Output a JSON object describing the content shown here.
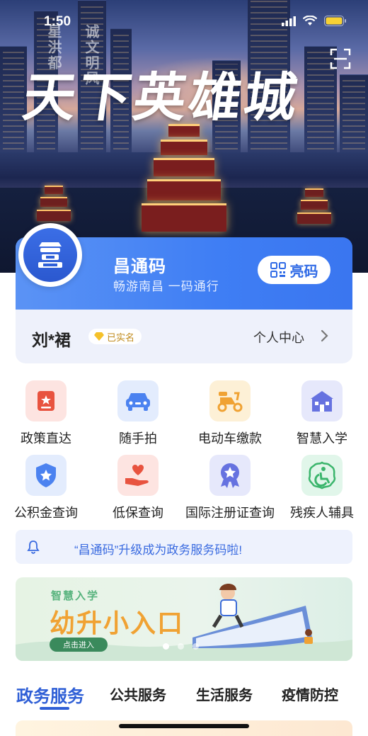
{
  "status_bar": {
    "time": "1:50"
  },
  "hero": {
    "calligraphy": "天下英雄城",
    "vertical_left": "星洪都",
    "vertical_mid": "诚文明风"
  },
  "code_card": {
    "title": "昌通码",
    "subtitle": "畅游南昌 一码通行",
    "show_code_label": "亮码",
    "user_name": "刘*裙",
    "verified_label": "已实名",
    "personal_center_label": "个人中心"
  },
  "grid": [
    {
      "label": "政策直达",
      "icon": "policy-icon",
      "bg": "#fde4e1",
      "color": "#e8533f"
    },
    {
      "label": "随手拍",
      "icon": "car-icon",
      "bg": "#e3ecfd",
      "color": "#4b82f0"
    },
    {
      "label": "电动车缴款",
      "icon": "ebike-icon",
      "bg": "#fdf0d6",
      "color": "#f0a233"
    },
    {
      "label": "智慧入学",
      "icon": "school-icon",
      "bg": "#e6e8fb",
      "color": "#6672e0"
    },
    {
      "label": "公积金查询",
      "icon": "shield-star-icon",
      "bg": "#e3ecfd",
      "color": "#4b82f0"
    },
    {
      "label": "低保查询",
      "icon": "heart-hand-icon",
      "bg": "#fde4e1",
      "color": "#e8533f"
    },
    {
      "label": "国际注册证查询",
      "icon": "medal-icon",
      "bg": "#e6e8fb",
      "color": "#6672e0"
    },
    {
      "label": "残疾人辅具",
      "icon": "disability-icon",
      "bg": "#e1f6ea",
      "color": "#3bb56c"
    }
  ],
  "notice": {
    "text": "“昌通码”升级成为政务服务码啦!"
  },
  "banner": {
    "subtitle": "智慧入学",
    "title": "幼升小入口",
    "button": "点击进入"
  },
  "tabs": [
    {
      "label": "政务服务",
      "active": true
    },
    {
      "label": "公共服务",
      "active": false
    },
    {
      "label": "生活服务",
      "active": false
    },
    {
      "label": "疫情防控",
      "active": false
    }
  ],
  "colors": {
    "accent": "#3f7ef4",
    "tab_active": "#2f5fd6",
    "notice_text": "#3a6be0"
  }
}
